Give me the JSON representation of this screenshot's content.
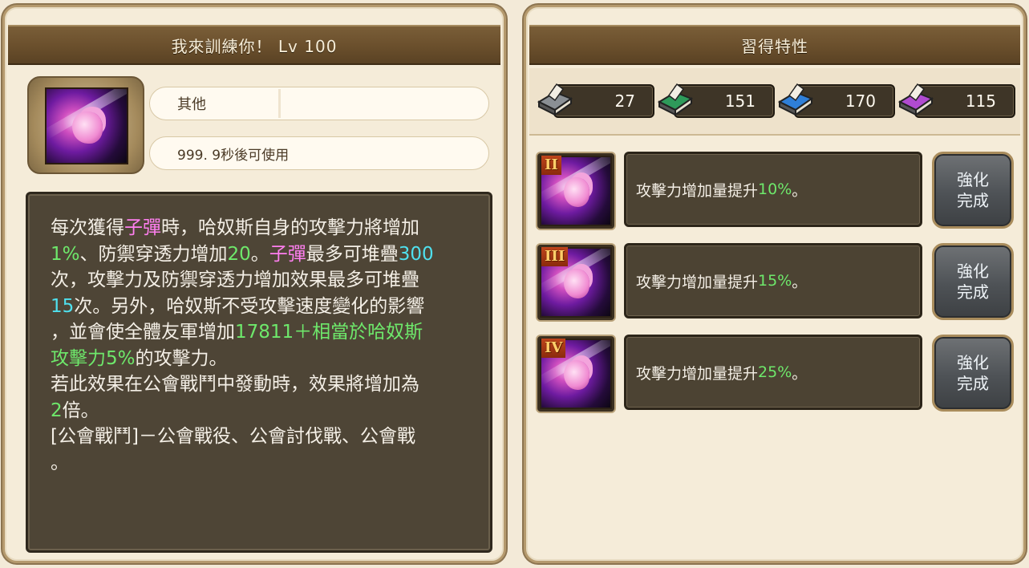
{
  "left_panel": {
    "title": "我來訓練你！ Lv 100",
    "category": "其他",
    "cooldown": "999. 9秒後可使用",
    "description_lines": [
      [
        {
          "t": "每次獲得"
        },
        {
          "t": "子彈",
          "c": "pink"
        },
        {
          "t": "時，哈奴斯自身的攻擊力將增加"
        }
      ],
      [
        {
          "t": "1%",
          "c": "green"
        },
        {
          "t": "、防禦穿透力增加"
        },
        {
          "t": "20",
          "c": "green"
        },
        {
          "t": "。"
        },
        {
          "t": "子彈",
          "c": "pink"
        },
        {
          "t": "最多可堆疊"
        },
        {
          "t": "300",
          "c": "cyan"
        }
      ],
      [
        {
          "t": "次，攻擊力及防禦穿透力增加效果最多可堆疊"
        }
      ],
      [
        {
          "t": "15",
          "c": "cyan"
        },
        {
          "t": "次。另外，哈奴斯不受攻擊速度變化的影響"
        }
      ],
      [
        {
          "t": "，並會使全體友軍增加"
        },
        {
          "t": "17811＋相當於哈奴斯",
          "c": "green"
        }
      ],
      [
        {
          "t": "攻擊力5%",
          "c": "green"
        },
        {
          "t": "的攻擊力。"
        }
      ],
      [
        {
          "t": "若此效果在公會戰鬥中發動時，效果將增加為"
        }
      ],
      [
        {
          "t": "2",
          "c": "green"
        },
        {
          "t": "倍。"
        }
      ],
      [
        {
          "t": "[公會戰鬥]－公會戰役、公會討伐戰、公會戰"
        }
      ],
      [
        {
          "t": "。"
        }
      ]
    ]
  },
  "right_panel": {
    "title": "習得特性",
    "book_counts": [
      {
        "icon": "gray-book-icon",
        "value": "27",
        "color": "#8a8f94"
      },
      {
        "icon": "green-book-icon",
        "value": "151",
        "color": "#2e9a5a"
      },
      {
        "icon": "blue-book-icon",
        "value": "170",
        "color": "#2f7fd8"
      },
      {
        "icon": "purple-book-icon",
        "value": "115",
        "color": "#b04bd0"
      }
    ],
    "traits": [
      {
        "roman": "II",
        "text_prefix": "攻擊力增加量提升",
        "value": "10%",
        "suffix": "。",
        "button_line1": "強化",
        "button_line2": "完成"
      },
      {
        "roman": "III",
        "text_prefix": "攻擊力增加量提升",
        "value": "15%",
        "suffix": "。",
        "button_line1": "強化",
        "button_line2": "完成"
      },
      {
        "roman": "IV",
        "text_prefix": "攻擊力增加量提升",
        "value": "25%",
        "suffix": "。",
        "button_line1": "強化",
        "button_line2": "完成"
      }
    ]
  }
}
